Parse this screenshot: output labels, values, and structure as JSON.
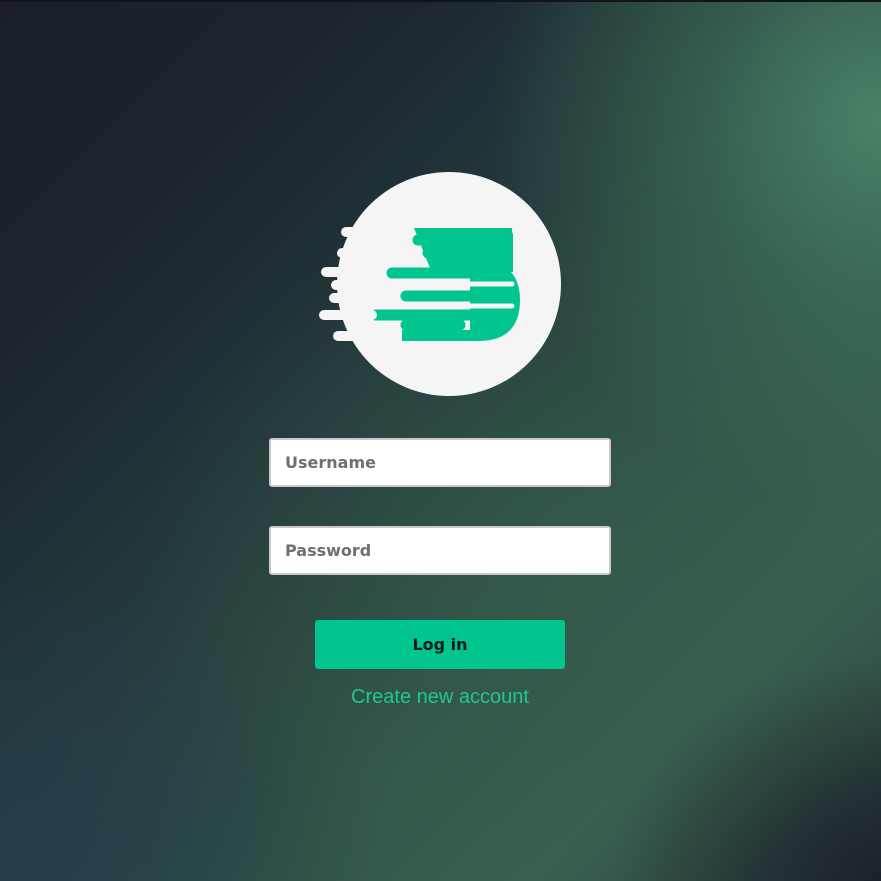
{
  "app": {
    "logo_icon": "speed-s-logo-icon",
    "brand_color": "#00c58e",
    "link_color": "#1fc792"
  },
  "form": {
    "username_placeholder": "Username",
    "password_placeholder": "Password",
    "login_label": "Log in",
    "create_account_label": "Create new account"
  }
}
